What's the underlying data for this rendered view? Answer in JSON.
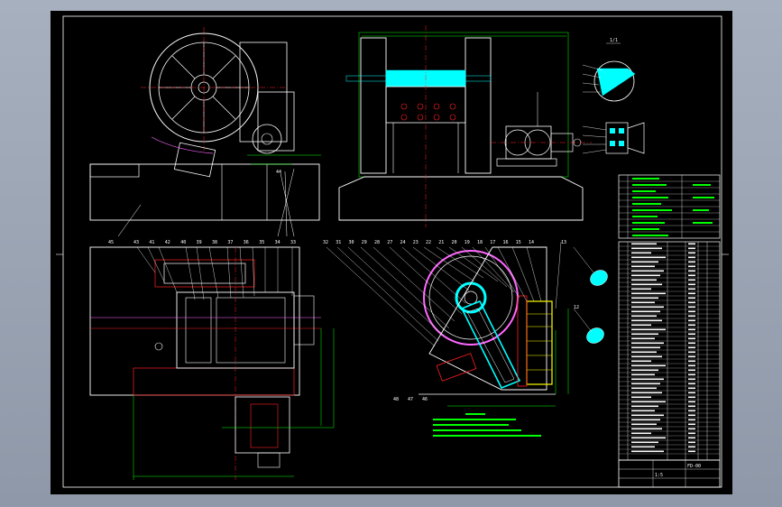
{
  "colors": {
    "background": "#000000",
    "outline": "#ffffff",
    "dimension": "#00ff00",
    "center": "#ff2020",
    "hatch": "#00ffff",
    "flywheel": "#ff66ff",
    "frame": "#ffff00"
  },
  "section_label": "1/1",
  "balloons_bottom_left": [
    "43",
    "41",
    "42",
    "40",
    "39",
    "38",
    "37",
    "36",
    "35",
    "34",
    "33"
  ],
  "balloons_bottom_middle": [
    "32",
    "31",
    "30",
    "29",
    "28",
    "27",
    "24",
    "23",
    "22",
    "21",
    "20",
    "19",
    "18",
    "17",
    "16",
    "15",
    "14"
  ],
  "balloons_small_right": [
    "13",
    "12"
  ],
  "balloons_foot": [
    "48",
    "47",
    "46"
  ],
  "balloon_left_side": "45",
  "balloon_top_left": "44",
  "title_block": {
    "drawing_no": "FD-00",
    "scale": "1:5"
  }
}
